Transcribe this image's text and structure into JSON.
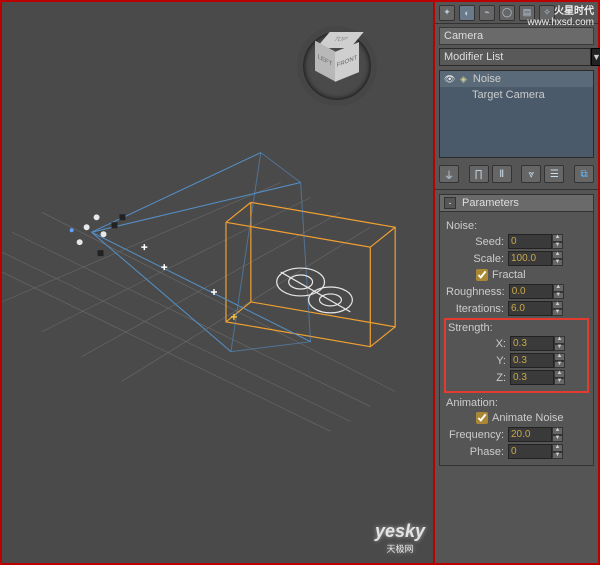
{
  "watermarks": {
    "top_brand": "火星时代",
    "top_url": "www.hxsd.com",
    "bottom_brand": "yesky",
    "bottom_sub": "天极网"
  },
  "viewcube": {
    "top": "TOP",
    "left": "LEFT",
    "front": "FRONT"
  },
  "panel": {
    "object_name": "Camera",
    "modifier_list_label": "Modifier List",
    "stack": {
      "items": [
        {
          "icon": "◈",
          "label": "Noise"
        },
        {
          "icon": "",
          "label": "Target Camera"
        }
      ]
    },
    "rollout": {
      "title": "Parameters",
      "noise_label": "Noise:",
      "seed": {
        "label": "Seed:",
        "value": "0"
      },
      "scale": {
        "label": "Scale:",
        "value": "100.0"
      },
      "fractal": {
        "label": "Fractal",
        "checked": true
      },
      "roughness": {
        "label": "Roughness:",
        "value": "0.0"
      },
      "iterations": {
        "label": "Iterations:",
        "value": "6.0"
      },
      "strength_label": "Strength:",
      "x": {
        "label": "X:",
        "value": "0.3"
      },
      "y": {
        "label": "Y:",
        "value": "0.3"
      },
      "z": {
        "label": "Z:",
        "value": "0.3"
      },
      "animation_label": "Animation:",
      "animate_noise": {
        "label": "Animate Noise",
        "checked": true
      },
      "frequency": {
        "label": "Frequency:",
        "value": "20.0"
      },
      "phase": {
        "label": "Phase:",
        "value": "0"
      }
    }
  }
}
